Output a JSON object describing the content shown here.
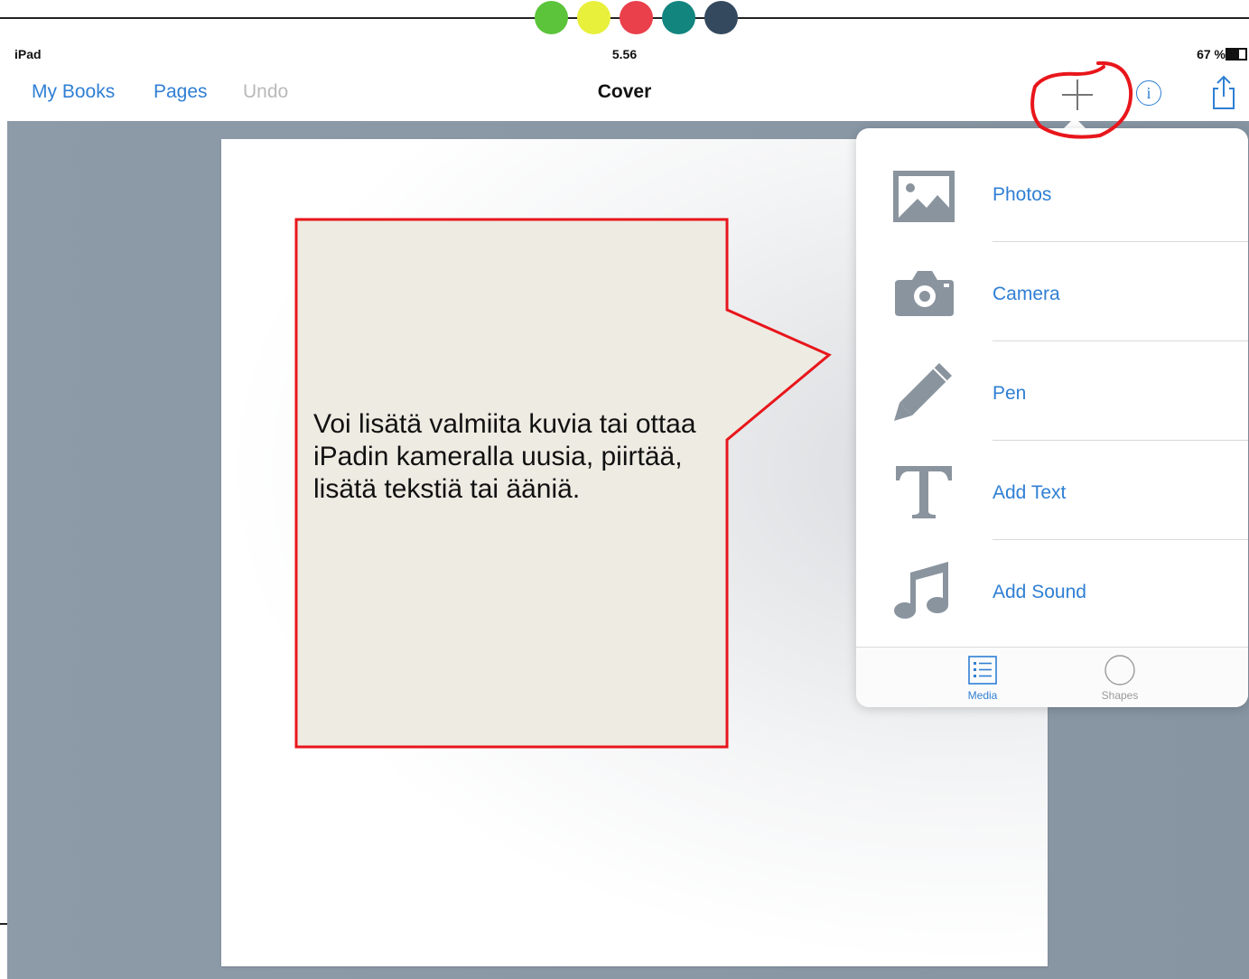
{
  "decoration": {
    "dot_colors": [
      "#5cc43a",
      "#e8f03c",
      "#e9404b",
      "#12857f",
      "#34495e"
    ]
  },
  "statusbar": {
    "device": "iPad",
    "time": "5.56",
    "battery_text": "67 %",
    "battery_level_percent": 67
  },
  "navbar": {
    "my_books": "My Books",
    "pages": "Pages",
    "undo": "Undo",
    "title": "Cover",
    "add_icon": "plus-icon",
    "info_icon": "info-icon",
    "info_glyph": "i",
    "share_icon": "share-icon"
  },
  "callout": {
    "text": "Voi lisätä valmiita kuvia tai ottaa iPadin kameralla uusia, piirtää, lisätä tekstiä tai ääniä."
  },
  "popover": {
    "items": [
      {
        "label": "Photos",
        "icon": "photo-icon"
      },
      {
        "label": "Camera",
        "icon": "camera-icon"
      },
      {
        "label": "Pen",
        "icon": "pen-icon"
      },
      {
        "label": "Add Text",
        "icon": "text-icon"
      },
      {
        "label": "Add Sound",
        "icon": "music-note-icon"
      }
    ],
    "tabs": [
      {
        "label": "Media",
        "icon": "list-icon",
        "selected": true
      },
      {
        "label": "Shapes",
        "icon": "circle-icon",
        "selected": false
      }
    ]
  },
  "colors": {
    "accent": "#2f7fd4",
    "icon_gray": "#8a949e",
    "annotation_red": "#e8161b",
    "callout_fill": "#edebe2"
  }
}
